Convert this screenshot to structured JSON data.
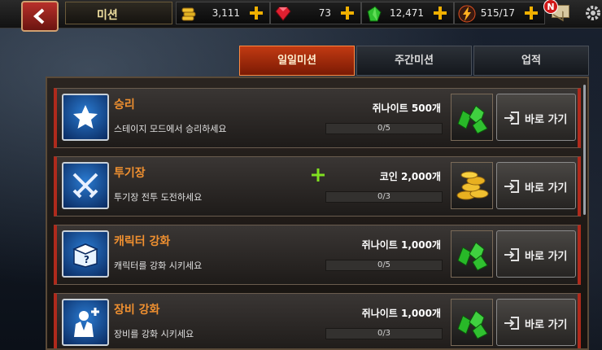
{
  "header": {
    "title": "미션",
    "coins": "3,111",
    "gems": "73",
    "jeonite": "12,471",
    "energy": "515/17",
    "mail_badge": "N"
  },
  "tabs": [
    {
      "label": "일일미션",
      "active": true
    },
    {
      "label": "주간미션",
      "active": false
    },
    {
      "label": "업적",
      "active": false
    }
  ],
  "missions": [
    {
      "title": "승리",
      "desc": "스테이지 모드에서 승리하세요",
      "reward": "쥐나이트 500개",
      "progress": "0/5",
      "icon": "star-icon",
      "reward_icon": "green-crystal-icon"
    },
    {
      "title": "투기장",
      "desc": "투기장 전투 도전하세요",
      "reward": "코인 2,000개",
      "progress": "0/3",
      "icon": "crossed-swords-icon",
      "reward_icon": "gold-coins-icon"
    },
    {
      "title": "캐릭터 강화",
      "desc": "캐릭터를 강화 시키세요",
      "reward": "쥐나이트 1,000개",
      "progress": "0/5",
      "icon": "mystery-box-icon",
      "reward_icon": "green-crystal-icon"
    },
    {
      "title": "장비 강화",
      "desc": "장비를 강화 시키세요",
      "reward": "쥐나이트 1,000개",
      "progress": "0/3",
      "icon": "equipment-upgrade-icon",
      "reward_icon": "green-crystal-icon"
    }
  ],
  "go_label": "바로 가기",
  "colors": {
    "accent": "#c23a12",
    "title_orange": "#f09030",
    "row_border": "#b02a1c"
  }
}
